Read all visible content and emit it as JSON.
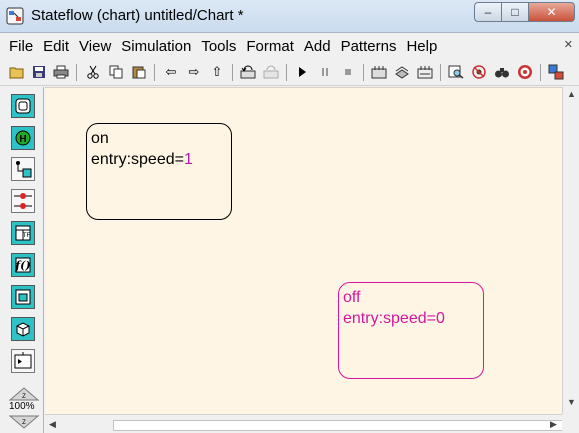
{
  "window": {
    "title": "Stateflow (chart) untitled/Chart *",
    "controls": {
      "minimize": "–",
      "maximize": "□",
      "close": "✕"
    }
  },
  "menu": {
    "items": [
      "File",
      "Edit",
      "View",
      "Simulation",
      "Tools",
      "Format",
      "Add",
      "Patterns",
      "Help"
    ],
    "close_glyph": "✕"
  },
  "toolbar": {
    "icons": [
      "open-icon",
      "save-icon",
      "print-icon",
      "cut-icon",
      "copy-icon",
      "paste-icon",
      "back-icon",
      "forward-icon",
      "up-icon",
      "undo-icon",
      "redo-icon",
      "start-icon",
      "pause-icon",
      "stop-icon",
      "build-icon",
      "rebuild-icon",
      "library-icon",
      "explorer-icon",
      "debug-icon",
      "find-icon",
      "target-icon",
      "model-icon"
    ]
  },
  "palette": {
    "tools": [
      "state-tool",
      "history-junction-tool",
      "default-transition-tool",
      "connective-junction-tool",
      "truth-table-tool",
      "graphical-function-tool",
      "embedded-matlab-tool",
      "box-tool",
      "simulink-function-tool"
    ],
    "zoom": "100%"
  },
  "chart": {
    "states": {
      "on": {
        "name": "on",
        "entry_prefix": "entry:speed=",
        "entry_value": "1"
      },
      "off": {
        "name": "off",
        "entry_prefix": "entry:speed=",
        "entry_value": "0"
      }
    }
  },
  "colors": {
    "canvas": "#fff5e4",
    "selected_state": "#d6179c",
    "palette_accent": "#2ec2c6"
  }
}
